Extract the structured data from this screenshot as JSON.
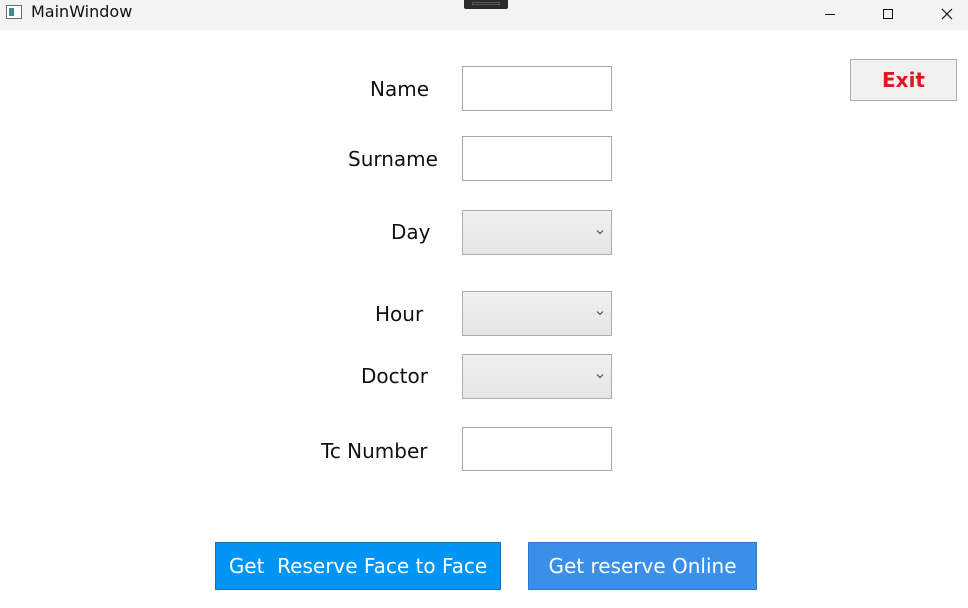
{
  "window": {
    "title": "MainWindow",
    "icons": {
      "app": "app-window-icon",
      "minimize": "minimize-icon",
      "maximize": "maximize-icon",
      "close": "close-icon"
    }
  },
  "form": {
    "name_label": "Name",
    "name_value": "",
    "surname_label": "Surname",
    "surname_value": "",
    "day_label": "Day",
    "day_value": "",
    "hour_label": "Hour",
    "hour_value": "",
    "doctor_label": "Doctor",
    "doctor_value": "",
    "tc_label": "Tc Number",
    "tc_value": ""
  },
  "actions": {
    "exit_label": "Exit",
    "face_to_face_label": "Get  Reserve Face to Face",
    "online_label": "Get reserve Online"
  },
  "colors": {
    "exit_text": "#e5131b",
    "face_button": "#0094f4",
    "online_button": "#3b8fe8"
  }
}
